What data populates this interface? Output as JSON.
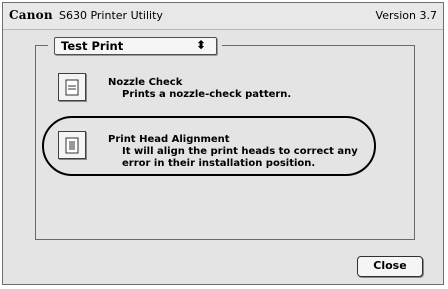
{
  "window": {
    "brand": "Canon",
    "title": "S630 Printer Utility",
    "version": "Version 3.7"
  },
  "panel": {
    "popup_selected": "Test Print",
    "popup_arrow_icon": "up-down-arrows-icon"
  },
  "items": [
    {
      "title": "Nozzle Check",
      "description": "Prints a nozzle-check pattern.",
      "icon": "nozzle-check-icon"
    },
    {
      "title": "Print Head Alignment",
      "description_line1": "It will align the print heads to correct any",
      "description_line2": "error in their installation position.",
      "icon": "print-head-alignment-icon"
    }
  ],
  "buttons": {
    "close_label": "Close"
  }
}
